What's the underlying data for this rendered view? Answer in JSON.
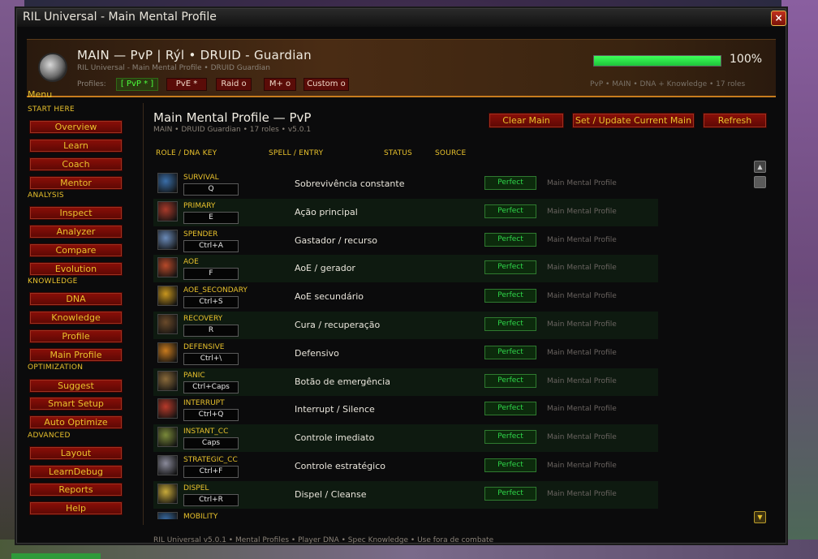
{
  "window": {
    "title": "RIL Universal - Main Mental Profile",
    "close_icon": "×"
  },
  "header": {
    "title": "MAIN — PvP   |   Rýl • DRUID - Guardian",
    "subtitle": "RIL Universal - Main Mental Profile  •  DRUID Guardian",
    "profiles_label": "Profiles:",
    "profile_tabs": [
      {
        "label": "[ PvP * ]",
        "active": true
      },
      {
        "label": "PvE *",
        "active": false
      },
      {
        "label": "Raid o",
        "active": false
      },
      {
        "label": "M+ o",
        "active": false
      },
      {
        "label": "Custom o",
        "active": false
      }
    ],
    "progress": 1.0,
    "progress_label": "100%",
    "tags": "PvP • MAIN • DNA + Knowledge • 17 roles"
  },
  "sidebar": {
    "menu_title": "Menu",
    "sections": [
      {
        "label": "START HERE",
        "items": [
          "Overview",
          "Learn",
          "Coach",
          "Mentor"
        ]
      },
      {
        "label": "ANALYSIS",
        "items": [
          "Inspect",
          "Analyzer",
          "Compare",
          "Evolution"
        ]
      },
      {
        "label": "KNOWLEDGE",
        "items": [
          "DNA",
          "Knowledge",
          "Profile",
          "Main Profile"
        ]
      },
      {
        "label": "OPTIMIZATION",
        "items": [
          "Suggest",
          "Smart Setup",
          "Auto Optimize"
        ]
      },
      {
        "label": "ADVANCED",
        "items": [
          "Layout",
          "LearnDebug",
          "Reports",
          "Help"
        ]
      }
    ]
  },
  "main": {
    "title": "Main Mental Profile — PvP",
    "subtitle": "MAIN • DRUID Guardian • 17 roles • v5.0.1",
    "buttons": {
      "clear": "Clear Main",
      "set_update": "Set / Update Current Main",
      "refresh": "Refresh"
    },
    "columns": [
      "ROLE / DNA KEY",
      "SPELL / ENTRY",
      "STATUS",
      "SOURCE"
    ],
    "rows": [
      {
        "role": "SURVIVAL",
        "key": "Q",
        "entry": "Sobrevivência constante",
        "status": "Perfect",
        "source": "Main Mental Profile",
        "icon": "frost-spell-icon",
        "color": "#3a6ea8"
      },
      {
        "role": "PRIMARY",
        "key": "E",
        "entry": "Ação principal",
        "status": "Perfect",
        "source": "Main Mental Profile",
        "icon": "bear-maul-icon",
        "color": "#a83a2a"
      },
      {
        "role": "SPENDER",
        "key": "Ctrl+A",
        "entry": "Gastador / recurso",
        "status": "Perfect",
        "source": "Main Mental Profile",
        "icon": "bear-claw-icon",
        "color": "#6a8ab8"
      },
      {
        "role": "AOE",
        "key": "F",
        "entry": "AoE / gerador",
        "status": "Perfect",
        "source": "Main Mental Profile",
        "icon": "thrash-icon",
        "color": "#b84a2a"
      },
      {
        "role": "AOE_SECONDARY",
        "key": "Ctrl+S",
        "entry": "AoE secundário",
        "status": "Perfect",
        "source": "Main Mental Profile",
        "icon": "swipe-icon",
        "color": "#c8961e"
      },
      {
        "role": "RECOVERY",
        "key": "R",
        "entry": "Cura / recuperação",
        "status": "Perfect",
        "source": "Main Mental Profile",
        "icon": "frenzied-regen-icon",
        "color": "#6a4a2a"
      },
      {
        "role": "DEFENSIVE",
        "key": "Ctrl+\\",
        "entry": "Defensivo",
        "status": "Perfect",
        "source": "Main Mental Profile",
        "icon": "barkskin-icon",
        "color": "#c87a1e"
      },
      {
        "role": "PANIC",
        "key": "Ctrl+Caps",
        "entry": "Botão de emergência",
        "status": "Perfect",
        "source": "Main Mental Profile",
        "icon": "survival-instincts-icon",
        "color": "#8a6a3a"
      },
      {
        "role": "INTERRUPT",
        "key": "Ctrl+Q",
        "entry": "Interrupt / Silence",
        "status": "Perfect",
        "source": "Main Mental Profile",
        "icon": "skull-bash-icon",
        "color": "#b83a2a"
      },
      {
        "role": "INSTANT_CC",
        "key": "Caps",
        "entry": "Controle imediato",
        "status": "Perfect",
        "source": "Main Mental Profile",
        "icon": "incapacitating-roar-icon",
        "color": "#7a8a3a"
      },
      {
        "role": "STRATEGIC_CC",
        "key": "Ctrl+F",
        "entry": "Controle estratégico",
        "status": "Perfect",
        "source": "Main Mental Profile",
        "icon": "cyclone-icon",
        "color": "#8a8a9a"
      },
      {
        "role": "DISPEL",
        "key": "Ctrl+R",
        "entry": "Dispel / Cleanse",
        "status": "Perfect",
        "source": "Main Mental Profile",
        "icon": "remove-corruption-icon",
        "color": "#c8aa3a"
      },
      {
        "role": "MOBILITY",
        "key": "",
        "entry": "",
        "status": "",
        "source": "",
        "icon": "stampeding-roar-icon",
        "color": "#3a6ea8"
      }
    ]
  },
  "footer": "RIL Universal v5.0.1  •  Mental Profiles  •  Player DNA  •  Spec Knowledge  •  Use fora de combate"
}
